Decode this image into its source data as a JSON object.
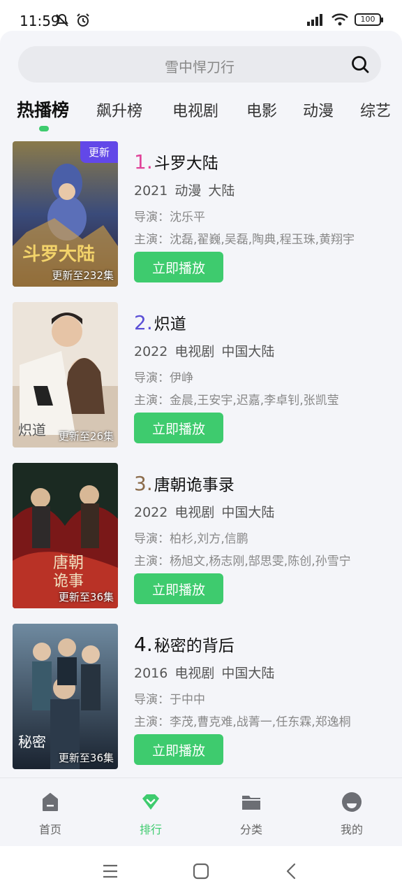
{
  "status": {
    "time": "11:59",
    "battery": "100"
  },
  "search": {
    "placeholder": "雪中悍刀行"
  },
  "tabs": [
    {
      "label": "热播榜",
      "active": true
    },
    {
      "label": "飙升榜"
    },
    {
      "label": "电视剧"
    },
    {
      "label": "电影"
    },
    {
      "label": "动漫"
    },
    {
      "label": "综艺"
    }
  ],
  "items": [
    {
      "rank": "1.",
      "rank_color": "#e04399",
      "title": "斗罗大陆",
      "meta": "2021 动漫 大陆",
      "director": "导演：沈乐平",
      "cast": "主演：沈磊,翟巍,吴磊,陶典,程玉珠,黄翔宇",
      "badge": "更新",
      "episodes": "更新至232集",
      "play_label": "立即播放",
      "poster_colors": [
        "#3a4b7a",
        "#d9a441",
        "#2a1e2e"
      ]
    },
    {
      "rank": "2.",
      "rank_color": "#5b4fd6",
      "title": "炽道",
      "meta": "2022 电视剧 中国大陆",
      "director": "导演：伊峥",
      "cast": "主演：金晨,王安宇,迟嘉,李卓钊,张凯莹",
      "badge": "",
      "episodes": "更新至26集",
      "play_label": "立即播放",
      "poster_colors": [
        "#e9dccd",
        "#b89577",
        "#ffffff"
      ]
    },
    {
      "rank": "3.",
      "rank_color": "#8b6b4a",
      "title": "唐朝诡事录",
      "meta": "2022 电视剧 中国大陆",
      "director": "导演：柏杉,刘方,信鹏",
      "cast": "主演：杨旭文,杨志刚,郜思雯,陈创,孙雪宁",
      "badge": "",
      "episodes": "更新至36集",
      "play_label": "立即播放",
      "poster_colors": [
        "#7a1818",
        "#1b3a2a",
        "#c93a2a"
      ]
    },
    {
      "rank": "4.",
      "rank_color": "#111111",
      "title": "秘密的背后",
      "meta": "2016 电视剧 中国大陆",
      "director": "导演：于中中",
      "cast": "主演：李茂,曹克难,战菁一,任东霖,郑逸桐",
      "badge": "",
      "episodes": "更新至36集",
      "play_label": "立即播放",
      "poster_colors": [
        "#2c3a4a",
        "#6f8aa0",
        "#1a2330"
      ]
    }
  ],
  "bottom_nav": [
    {
      "label": "首页",
      "icon": "home-icon"
    },
    {
      "label": "排行",
      "icon": "ranking-diamond-icon",
      "active": true
    },
    {
      "label": "分类",
      "icon": "folder-icon"
    },
    {
      "label": "我的",
      "icon": "profile-icon"
    }
  ],
  "colors": {
    "accent": "#3ecb6e",
    "badge": "#6248e8"
  }
}
